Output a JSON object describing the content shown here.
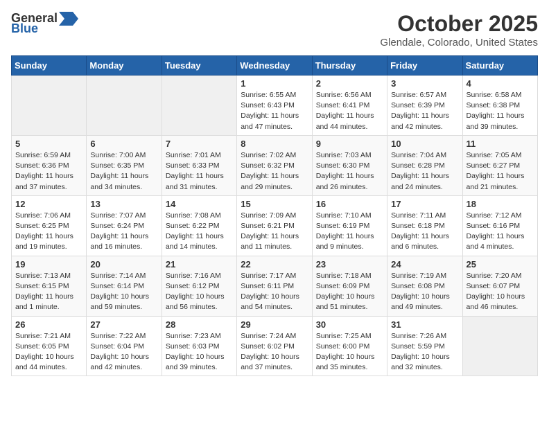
{
  "header": {
    "logo_general": "General",
    "logo_blue": "Blue",
    "month_title": "October 2025",
    "location": "Glendale, Colorado, United States"
  },
  "days_of_week": [
    "Sunday",
    "Monday",
    "Tuesday",
    "Wednesday",
    "Thursday",
    "Friday",
    "Saturday"
  ],
  "weeks": [
    [
      {
        "day": "",
        "info": ""
      },
      {
        "day": "",
        "info": ""
      },
      {
        "day": "",
        "info": ""
      },
      {
        "day": "1",
        "info": "Sunrise: 6:55 AM\nSunset: 6:43 PM\nDaylight: 11 hours\nand 47 minutes."
      },
      {
        "day": "2",
        "info": "Sunrise: 6:56 AM\nSunset: 6:41 PM\nDaylight: 11 hours\nand 44 minutes."
      },
      {
        "day": "3",
        "info": "Sunrise: 6:57 AM\nSunset: 6:39 PM\nDaylight: 11 hours\nand 42 minutes."
      },
      {
        "day": "4",
        "info": "Sunrise: 6:58 AM\nSunset: 6:38 PM\nDaylight: 11 hours\nand 39 minutes."
      }
    ],
    [
      {
        "day": "5",
        "info": "Sunrise: 6:59 AM\nSunset: 6:36 PM\nDaylight: 11 hours\nand 37 minutes."
      },
      {
        "day": "6",
        "info": "Sunrise: 7:00 AM\nSunset: 6:35 PM\nDaylight: 11 hours\nand 34 minutes."
      },
      {
        "day": "7",
        "info": "Sunrise: 7:01 AM\nSunset: 6:33 PM\nDaylight: 11 hours\nand 31 minutes."
      },
      {
        "day": "8",
        "info": "Sunrise: 7:02 AM\nSunset: 6:32 PM\nDaylight: 11 hours\nand 29 minutes."
      },
      {
        "day": "9",
        "info": "Sunrise: 7:03 AM\nSunset: 6:30 PM\nDaylight: 11 hours\nand 26 minutes."
      },
      {
        "day": "10",
        "info": "Sunrise: 7:04 AM\nSunset: 6:28 PM\nDaylight: 11 hours\nand 24 minutes."
      },
      {
        "day": "11",
        "info": "Sunrise: 7:05 AM\nSunset: 6:27 PM\nDaylight: 11 hours\nand 21 minutes."
      }
    ],
    [
      {
        "day": "12",
        "info": "Sunrise: 7:06 AM\nSunset: 6:25 PM\nDaylight: 11 hours\nand 19 minutes."
      },
      {
        "day": "13",
        "info": "Sunrise: 7:07 AM\nSunset: 6:24 PM\nDaylight: 11 hours\nand 16 minutes."
      },
      {
        "day": "14",
        "info": "Sunrise: 7:08 AM\nSunset: 6:22 PM\nDaylight: 11 hours\nand 14 minutes."
      },
      {
        "day": "15",
        "info": "Sunrise: 7:09 AM\nSunset: 6:21 PM\nDaylight: 11 hours\nand 11 minutes."
      },
      {
        "day": "16",
        "info": "Sunrise: 7:10 AM\nSunset: 6:19 PM\nDaylight: 11 hours\nand 9 minutes."
      },
      {
        "day": "17",
        "info": "Sunrise: 7:11 AM\nSunset: 6:18 PM\nDaylight: 11 hours\nand 6 minutes."
      },
      {
        "day": "18",
        "info": "Sunrise: 7:12 AM\nSunset: 6:16 PM\nDaylight: 11 hours\nand 4 minutes."
      }
    ],
    [
      {
        "day": "19",
        "info": "Sunrise: 7:13 AM\nSunset: 6:15 PM\nDaylight: 11 hours\nand 1 minute."
      },
      {
        "day": "20",
        "info": "Sunrise: 7:14 AM\nSunset: 6:14 PM\nDaylight: 10 hours\nand 59 minutes."
      },
      {
        "day": "21",
        "info": "Sunrise: 7:16 AM\nSunset: 6:12 PM\nDaylight: 10 hours\nand 56 minutes."
      },
      {
        "day": "22",
        "info": "Sunrise: 7:17 AM\nSunset: 6:11 PM\nDaylight: 10 hours\nand 54 minutes."
      },
      {
        "day": "23",
        "info": "Sunrise: 7:18 AM\nSunset: 6:09 PM\nDaylight: 10 hours\nand 51 minutes."
      },
      {
        "day": "24",
        "info": "Sunrise: 7:19 AM\nSunset: 6:08 PM\nDaylight: 10 hours\nand 49 minutes."
      },
      {
        "day": "25",
        "info": "Sunrise: 7:20 AM\nSunset: 6:07 PM\nDaylight: 10 hours\nand 46 minutes."
      }
    ],
    [
      {
        "day": "26",
        "info": "Sunrise: 7:21 AM\nSunset: 6:05 PM\nDaylight: 10 hours\nand 44 minutes."
      },
      {
        "day": "27",
        "info": "Sunrise: 7:22 AM\nSunset: 6:04 PM\nDaylight: 10 hours\nand 42 minutes."
      },
      {
        "day": "28",
        "info": "Sunrise: 7:23 AM\nSunset: 6:03 PM\nDaylight: 10 hours\nand 39 minutes."
      },
      {
        "day": "29",
        "info": "Sunrise: 7:24 AM\nSunset: 6:02 PM\nDaylight: 10 hours\nand 37 minutes."
      },
      {
        "day": "30",
        "info": "Sunrise: 7:25 AM\nSunset: 6:00 PM\nDaylight: 10 hours\nand 35 minutes."
      },
      {
        "day": "31",
        "info": "Sunrise: 7:26 AM\nSunset: 5:59 PM\nDaylight: 10 hours\nand 32 minutes."
      },
      {
        "day": "",
        "info": ""
      }
    ]
  ]
}
